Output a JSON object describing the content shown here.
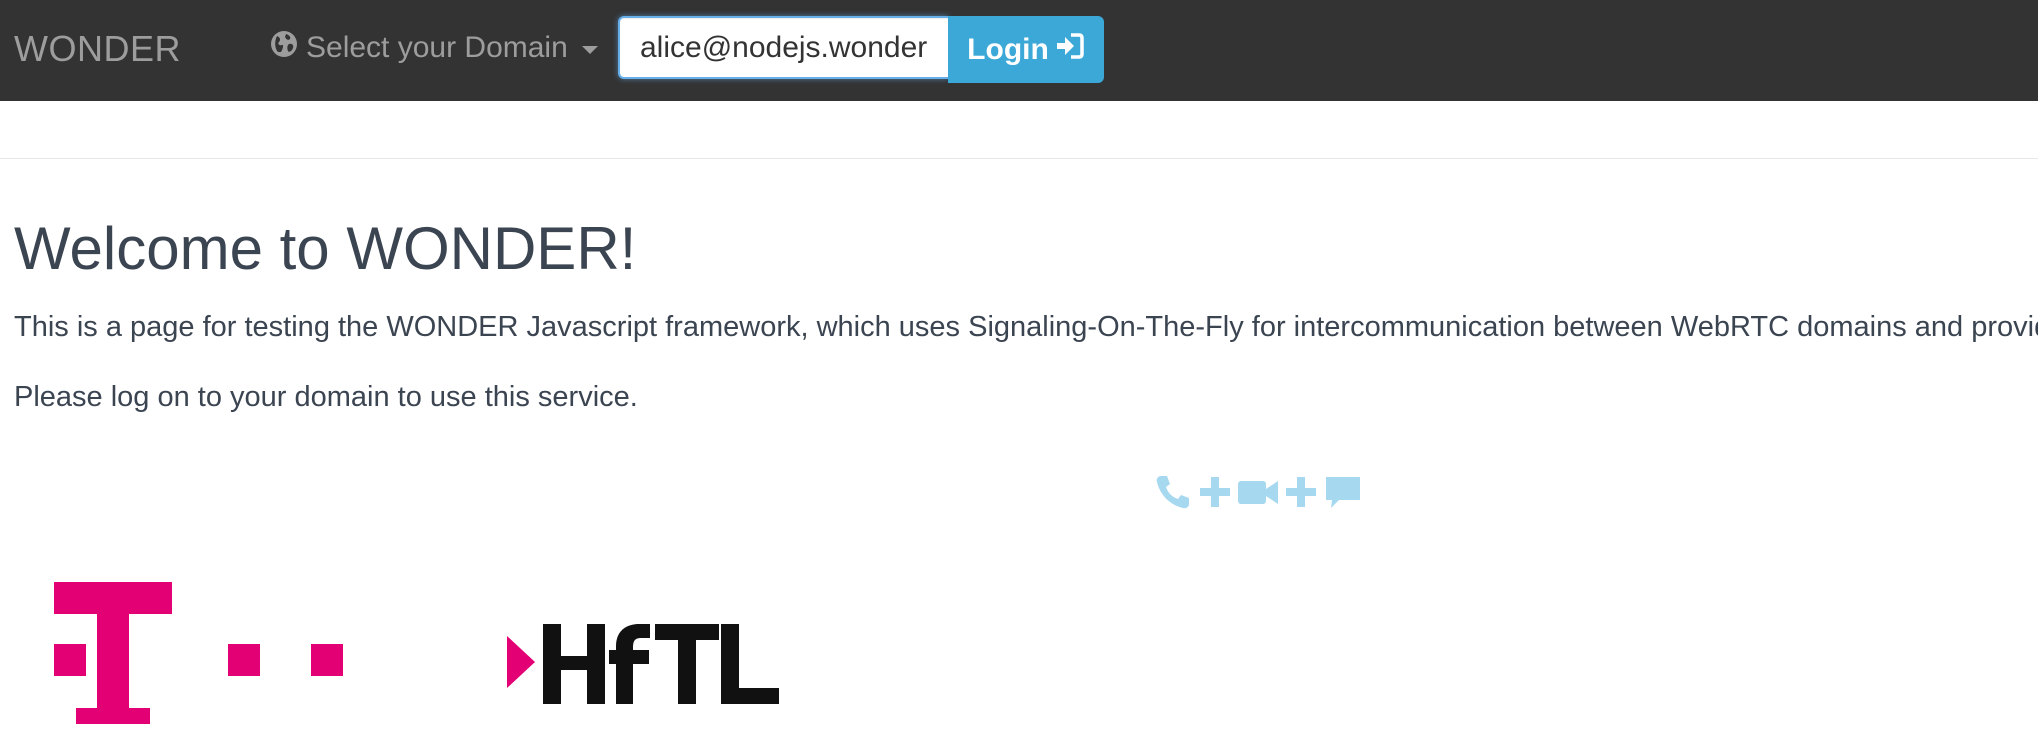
{
  "navbar": {
    "brand": "WONDER",
    "domain_select": {
      "label": "Select your Domain",
      "icon": "globe-icon"
    },
    "login": {
      "email_value": "alice@nodejs.wonder",
      "button_label": "Login",
      "button_icon": "sign-in-icon"
    }
  },
  "main": {
    "title": "Welcome to WONDER!",
    "intro": "This is a page for testing the WONDER Javascript framework, which uses Signaling-On-The-Fly for intercommunication between WebRTC domains and providers.",
    "instruction": "Please log on to your domain to use this service.",
    "feature_icons": [
      "phone-icon",
      "plus-icon",
      "video-camera-icon",
      "plus-icon",
      "chat-bubble-icon"
    ],
    "logos": {
      "telekom": "T",
      "hftl": "HfTL"
    }
  },
  "colors": {
    "navbar_bg": "#333333",
    "navbar_text": "#9d9d9d",
    "login_button": "#3ba8d8",
    "feature_icons": "#a6d9ef",
    "telekom_magenta": "#e20074",
    "text": "#3b4451"
  }
}
